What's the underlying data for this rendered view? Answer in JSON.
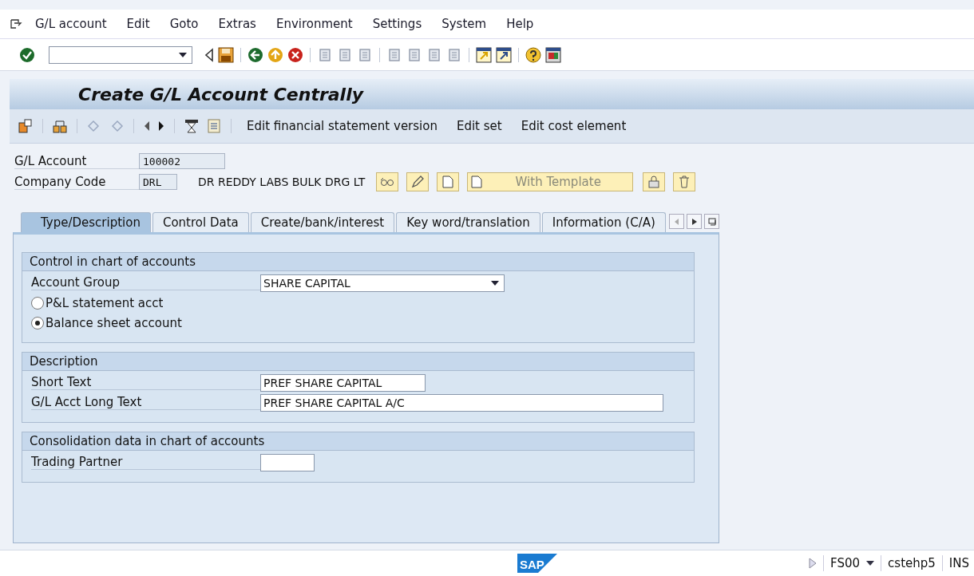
{
  "menu": [
    "G/L account",
    "Edit",
    "Goto",
    "Extras",
    "Environment",
    "Settings",
    "System",
    "Help"
  ],
  "title": "Create G/L Account Centrally",
  "app_toolbar": [
    "Edit financial statement version",
    "Edit set",
    "Edit cost element"
  ],
  "header": {
    "account_label": "G/L Account",
    "account_value": "100002",
    "company_label": "Company Code",
    "company_value": "DRL",
    "company_name": "DR REDDY LABS BULK DRG LT",
    "template_button": "With Template"
  },
  "tabs": [
    {
      "label": "Type/Description",
      "selected": true
    },
    {
      "label": "Control Data",
      "selected": false
    },
    {
      "label": "Create/bank/interest",
      "selected": false
    },
    {
      "label": "Key word/translation",
      "selected": false
    },
    {
      "label": "Information (C/A)",
      "selected": false
    }
  ],
  "sections": [
    {
      "title": "Control in chart of accounts",
      "rows": [
        {
          "kind": "dropdown",
          "label": "Account Group",
          "value": "SHARE CAPITAL"
        },
        {
          "kind": "radio",
          "label": "P&L statement acct",
          "selected": false
        },
        {
          "kind": "radio",
          "label": "Balance sheet account",
          "selected": true
        }
      ]
    },
    {
      "title": "Description",
      "rows": [
        {
          "kind": "field",
          "label": "Short Text",
          "value": "PREF SHARE CAPITAL"
        },
        {
          "kind": "field",
          "label": "G/L Acct Long Text",
          "value": "PREF SHARE CAPITAL A/C"
        }
      ]
    },
    {
      "title": "Consolidation data in chart of accounts",
      "rows": [
        {
          "kind": "field",
          "label": "Trading Partner",
          "value": ""
        }
      ]
    }
  ],
  "status_bar": {
    "logo": "SAP",
    "transaction": "FS00",
    "server": "cstehp5",
    "mode": "INS"
  }
}
